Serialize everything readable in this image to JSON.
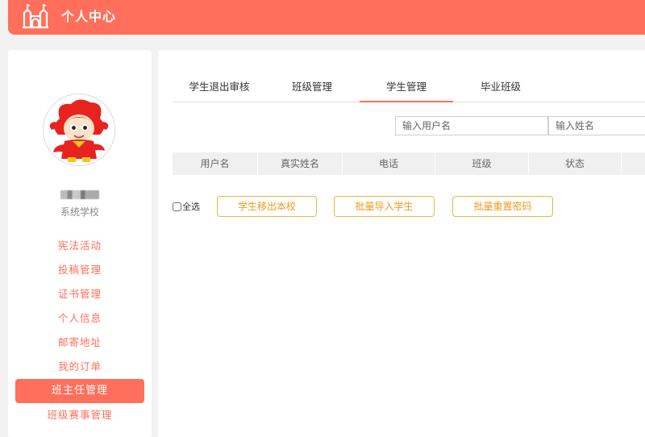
{
  "header": {
    "title": "个人中心",
    "icon": "castle-home-icon"
  },
  "sidebar": {
    "school": "系统学校",
    "items": [
      {
        "label": "宪法活动",
        "active": false
      },
      {
        "label": "投稿管理",
        "active": false
      },
      {
        "label": "证书管理",
        "active": false
      },
      {
        "label": "个人信息",
        "active": false
      },
      {
        "label": "邮寄地址",
        "active": false
      },
      {
        "label": "我的订单",
        "active": false
      },
      {
        "label": "班主任管理",
        "active": true
      },
      {
        "label": "班级赛事管理",
        "active": false
      }
    ]
  },
  "main": {
    "tabs": [
      {
        "label": "学生退出审核",
        "active": false
      },
      {
        "label": "班级管理",
        "active": false
      },
      {
        "label": "学生管理",
        "active": true
      },
      {
        "label": "毕业班级",
        "active": false
      }
    ],
    "search": {
      "username_placeholder": "输入用户名",
      "name_placeholder": "输入姓名"
    },
    "table": {
      "columns": [
        "用户名",
        "真实姓名",
        "电话",
        "班级",
        "状态"
      ]
    },
    "actions": {
      "select_all": "全选",
      "move_out": "学生移出本校",
      "batch_import": "批量导入学生",
      "batch_reset": "批量重置密码"
    }
  },
  "colors": {
    "accent": "#ff6f5b",
    "button_border": "#f4b33a",
    "button_text": "#f09a1a"
  }
}
